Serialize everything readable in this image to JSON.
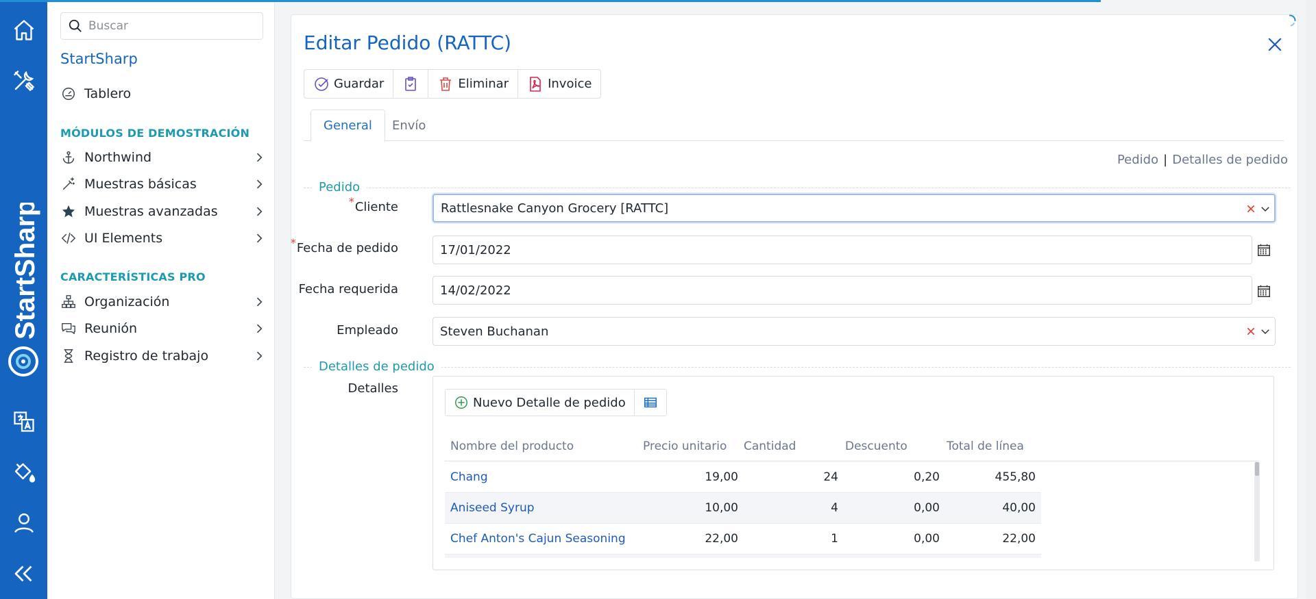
{
  "search": {
    "placeholder": "Buscar"
  },
  "sidebar": {
    "brand": "StartSharp",
    "dashboard": "Tablero",
    "section_demo": "MÓDULOS DE DEMOSTRACIÓN",
    "demo_items": [
      {
        "label": "Northwind",
        "icon": "anchor-icon"
      },
      {
        "label": "Muestras básicas",
        "icon": "magic-wand-icon"
      },
      {
        "label": "Muestras avanzadas",
        "icon": "star-icon"
      },
      {
        "label": "UI Elements",
        "icon": "code-icon"
      }
    ],
    "section_pro": "CARACTERÍSTICAS PRO",
    "pro_items": [
      {
        "label": "Organización",
        "icon": "org-chart-icon"
      },
      {
        "label": "Reunión",
        "icon": "chat-icon"
      },
      {
        "label": "Registro de trabajo",
        "icon": "hourglass-icon"
      }
    ]
  },
  "rail": {
    "brand_vertical": "StartSharp",
    "icons": [
      "home-icon",
      "tools-icon",
      "translate-icon",
      "paint-bucket-icon",
      "user-icon",
      "collapse-icon"
    ]
  },
  "dialog": {
    "title": "Editar Pedido (RATTC)",
    "toolbar": {
      "save": "Guardar",
      "delete": "Eliminar",
      "invoice": "Invoice"
    },
    "tabs": [
      "General",
      "Envío"
    ],
    "category_links": [
      "Pedido",
      "Detalles de pedido"
    ],
    "category_pedido": "Pedido",
    "category_detalles": "Detalles de pedido",
    "fields": {
      "cliente_label": "Cliente",
      "cliente_value": "Rattlesnake Canyon Grocery [RATTC]",
      "fecha_pedido_label": "Fecha de pedido",
      "fecha_pedido_value": "17/01/2022",
      "fecha_requerida_label": "Fecha requerida",
      "fecha_requerida_value": "14/02/2022",
      "empleado_label": "Empleado",
      "empleado_value": "Steven Buchanan",
      "detalles_label": "Detalles"
    },
    "grid": {
      "new_button": "Nuevo Detalle de pedido",
      "columns": [
        "Nombre del producto",
        "Precio unitario",
        "Cantidad",
        "Descuento",
        "Total de línea"
      ],
      "rows": [
        {
          "product": "Chang",
          "price": "19,00",
          "qty": "24",
          "discount": "0,20",
          "total": "455,80"
        },
        {
          "product": "Aniseed Syrup",
          "price": "10,00",
          "qty": "4",
          "discount": "0,00",
          "total": "40,00"
        },
        {
          "product": "Chef Anton's Cajun Seasoning",
          "price": "22,00",
          "qty": "1",
          "discount": "0,00",
          "total": "22,00"
        }
      ]
    }
  },
  "colors": {
    "rail": "#1565c0",
    "accent": "#1565c0",
    "section": "#1e9ab0",
    "required": "#e53935"
  }
}
